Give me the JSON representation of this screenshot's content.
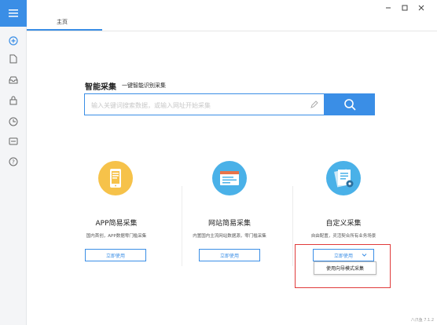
{
  "window": {
    "minimize_glyph": "—",
    "maximize_glyph": "☐",
    "close_glyph": "✕"
  },
  "sidebar": {
    "menu_icon": "hamburger-icon",
    "items": [
      {
        "icon": "plus-circle-icon"
      },
      {
        "icon": "file-icon"
      },
      {
        "icon": "inbox-icon"
      },
      {
        "icon": "lock-icon"
      },
      {
        "icon": "clock-icon"
      },
      {
        "icon": "chat-icon"
      },
      {
        "icon": "help-icon"
      }
    ]
  },
  "tabs": [
    {
      "label": "主页"
    }
  ],
  "search": {
    "title": "智能采集",
    "subtitle": "一键智能识别采集",
    "placeholder": "输入关键词搜索数据，或输入网址开始采集",
    "button_icon": "search-icon"
  },
  "cards": [
    {
      "title": "APP简易采集",
      "desc": "国内首创，APP数据零门槛采集",
      "button": "立即使用",
      "icon": "phone-icon",
      "color": "#f6c24a"
    },
    {
      "title": "网站简易采集",
      "desc": "内置国内主流网站数据源，零门槛采集",
      "button": "立即使用",
      "icon": "browser-icon",
      "color": "#4ab1e8"
    },
    {
      "title": "自定义采集",
      "desc": "自由配置，灵活契合所有业务场景",
      "button": "立即使用",
      "icon": "documents-gear-icon",
      "color": "#4ab1e8"
    }
  ],
  "dropdown": {
    "option": "使用向导模式采集"
  },
  "colors": {
    "accent": "#3a8ee6",
    "highlight": "#e03b3b"
  },
  "watermark": "八爪鱼 7.1.2"
}
